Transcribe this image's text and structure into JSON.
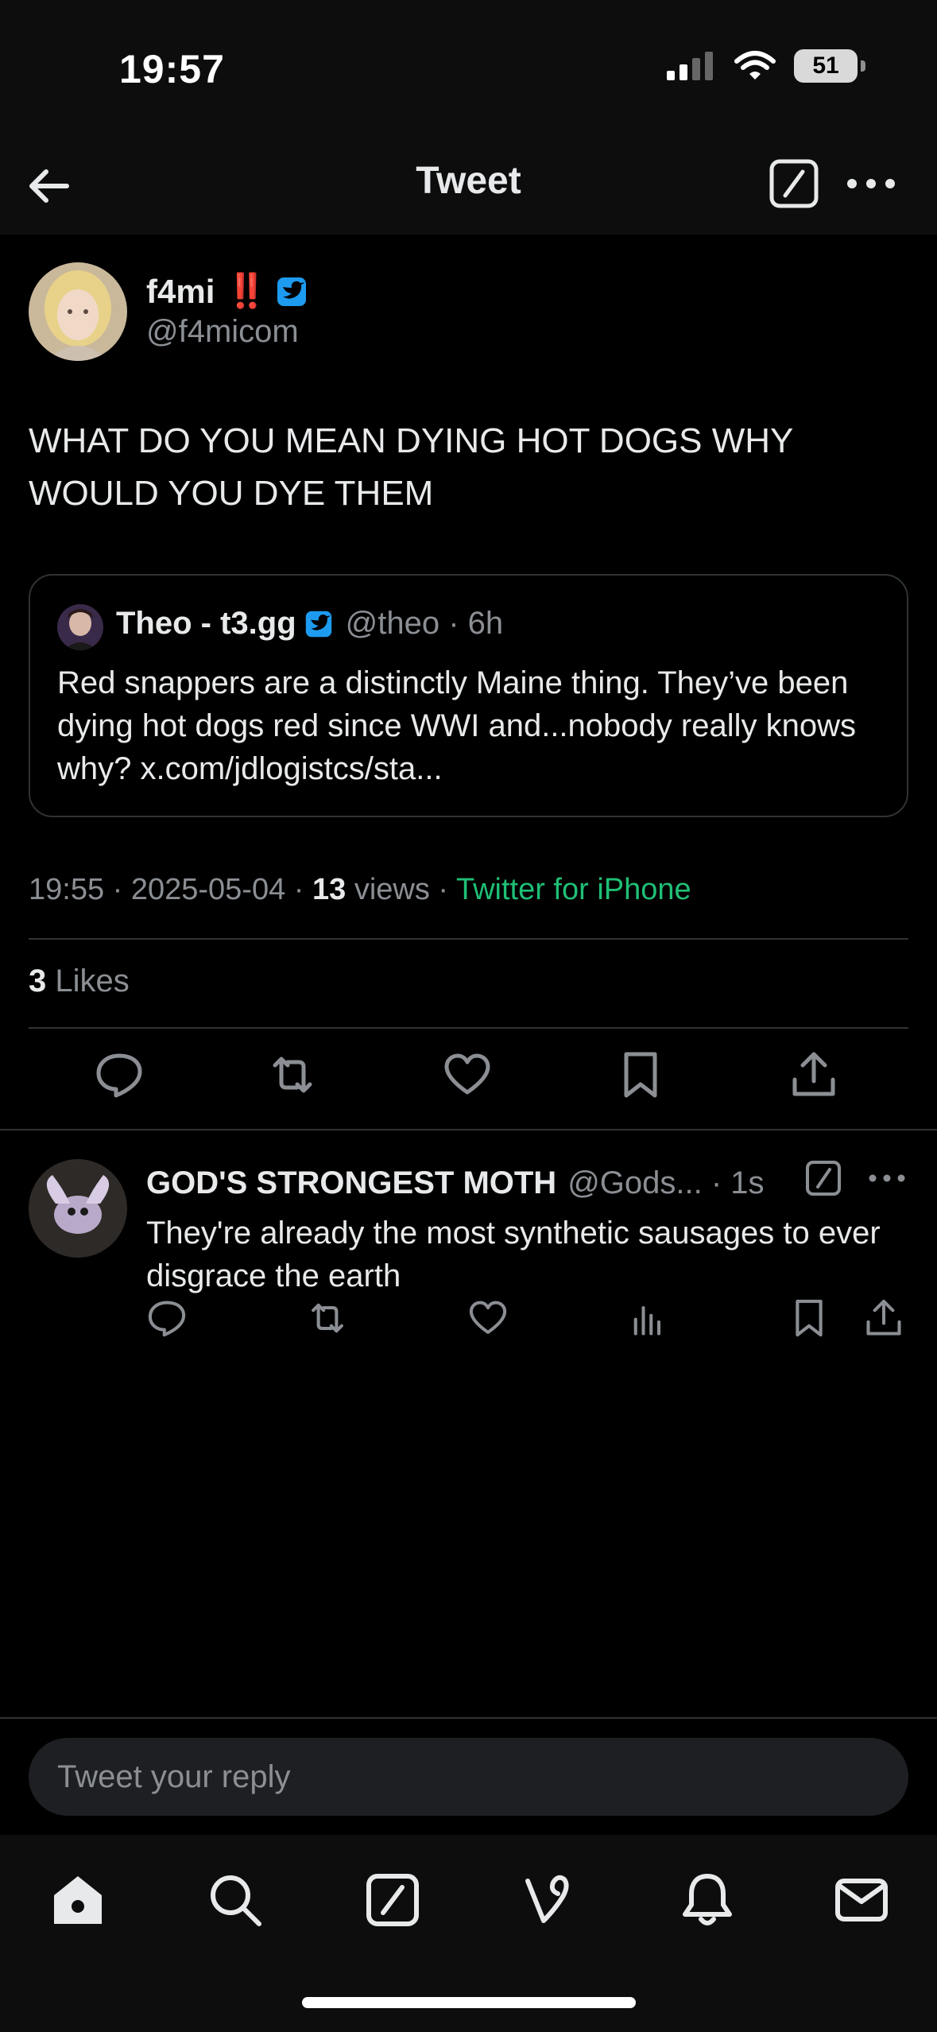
{
  "status_bar": {
    "time": "19:57",
    "battery": "51"
  },
  "nav": {
    "title": "Tweet"
  },
  "tweet": {
    "author_name": "f4mi",
    "author_badge": "‼️",
    "author_handle": "@f4micom",
    "text": "WHAT DO YOU MEAN DYING HOT DOGS WHY WOULD YOU DYE THEM",
    "quote": {
      "name": "Theo - t3.gg",
      "handle": "@theo · 6h",
      "text": "Red snappers are a distinctly Maine thing. They’ve been dying hot dogs red since WWI and...nobody really knows why? x.com/jdlogistcs/sta..."
    },
    "meta": {
      "timestamp": "19:55 · 2025-05-04 · ",
      "views_count": "13",
      "views_label": " views · ",
      "source": "Twitter for iPhone"
    },
    "likes": {
      "count": "3",
      "label": " Likes"
    }
  },
  "reply": {
    "name": "GOD'S STRONGEST MOTH",
    "handle": "@Gods... · 1s",
    "text": "They're already the most synthetic sausages to ever disgrace the earth"
  },
  "reply_bar": {
    "placeholder": "Tweet your reply"
  },
  "colors": {
    "accent_blue": "#1d9bf0",
    "source_green": "#1fbf75",
    "badge_red": "#e0245e",
    "muted": "#8b8f94"
  }
}
